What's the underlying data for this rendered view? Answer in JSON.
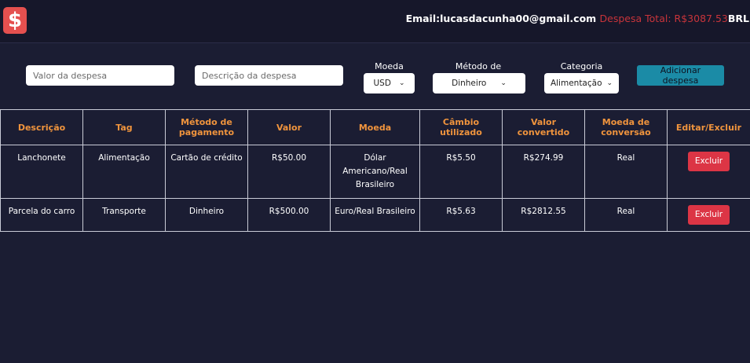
{
  "header": {
    "logo_glyph": "$",
    "email_label": "Email:",
    "email_value": "lucasdacunha00@gmail.com",
    "total_label": "Despesa Total: ",
    "total_value": "R$3087.53",
    "currency_code": "BRL"
  },
  "form": {
    "value_placeholder": "Valor da despesa",
    "description_placeholder": "Descrição da despesa",
    "currency_label": "Moeda",
    "currency_selected": "USD",
    "payment_label": "Método de pagamento",
    "payment_selected": "Dinheiro",
    "category_label": "Categoria",
    "category_selected": "Alimentação",
    "add_button": "Adicionar despesa"
  },
  "table": {
    "headers": [
      "Descrição",
      "Tag",
      "Método de pagamento",
      "Valor",
      "Moeda",
      "Câmbio utilizado",
      "Valor convertido",
      "Moeda de conversão",
      "Editar/Excluir"
    ],
    "rows": [
      {
        "descricao": "Lanchonete",
        "tag": "Alimentação",
        "metodo": "Cartão de crédito",
        "valor": "R$50.00",
        "moeda": "Dólar Americano/Real Brasileiro",
        "cambio": "R$5.50",
        "convertido": "R$274.99",
        "conversao": "Real",
        "acao": "Excluir"
      },
      {
        "descricao": "Parcela do carro",
        "tag": "Transporte",
        "metodo": "Dinheiro",
        "valor": "R$500.00",
        "moeda": "Euro/Real Brasileiro",
        "cambio": "R$5.63",
        "convertido": "R$2812.55",
        "conversao": "Real",
        "acao": "Excluir"
      }
    ]
  }
}
